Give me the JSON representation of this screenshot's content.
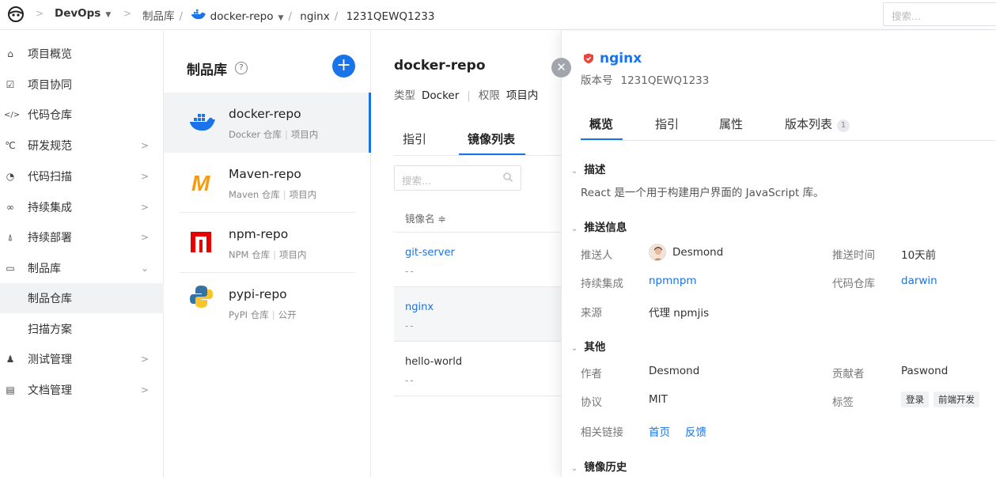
{
  "topbar": {
    "project": "DevOps",
    "breadcrumb": [
      "制品库",
      "docker-repo",
      "nginx",
      "1231QEWQ1233"
    ],
    "search_placeholder": "搜索..."
  },
  "nav": {
    "items": [
      {
        "label": "项目概览",
        "icon": "overview-icon"
      },
      {
        "label": "项目协同",
        "icon": "collab-icon"
      },
      {
        "label": "代码仓库",
        "icon": "code-icon"
      },
      {
        "label": "研发规范",
        "icon": "rule-icon"
      },
      {
        "label": "代码扫描",
        "icon": "scan-icon"
      },
      {
        "label": "持续集成",
        "icon": "ci-icon"
      },
      {
        "label": "持续部署",
        "icon": "deploy-icon"
      },
      {
        "label": "制品库",
        "icon": "artifact-icon"
      },
      {
        "label": "制品仓库",
        "icon": ""
      },
      {
        "label": "扫描方案",
        "icon": ""
      },
      {
        "label": "测试管理",
        "icon": "test-icon"
      },
      {
        "label": "文档管理",
        "icon": "doc-icon"
      }
    ]
  },
  "repos": {
    "title": "制品库",
    "items": [
      {
        "name": "docker-repo",
        "type": "Docker 仓库",
        "scope": "项目内"
      },
      {
        "name": "Maven-repo",
        "type": "Maven 仓库",
        "scope": "项目内"
      },
      {
        "name": "npm-repo",
        "type": "NPM 仓库",
        "scope": "项目内"
      },
      {
        "name": "pypi-repo",
        "type": "PyPI 仓库",
        "scope": "公开"
      }
    ]
  },
  "middle": {
    "title": "docker-repo",
    "type_label": "类型",
    "type_value": "Docker",
    "perm_label": "权限",
    "perm_value": "项目内",
    "tabs": [
      "指引",
      "镜像列表"
    ],
    "search_placeholder": "搜索...",
    "column_header": "镜像名 ≑",
    "images": [
      {
        "name": "git-server",
        "sub": "--"
      },
      {
        "name": "nginx",
        "sub": "--"
      },
      {
        "name": "hello-world",
        "sub": "--"
      }
    ]
  },
  "detail": {
    "title": "nginx",
    "version_label": "版本号",
    "version_value": "1231QEWQ1233",
    "tabs": [
      "概览",
      "指引",
      "属性",
      "版本列表"
    ],
    "version_count": "1",
    "sections": {
      "desc_title": "描述",
      "desc_text": "React 是一个用于构建用户界面的 JavaScript 库。",
      "push_title": "推送信息",
      "other_title": "其他",
      "history_title": "镜像历史"
    },
    "push": {
      "pusher_label": "推送人",
      "pusher_value": "Desmond",
      "time_label": "推送时间",
      "time_value": "10天前",
      "ci_label": "持续集成",
      "ci_value": "npmnpm",
      "repo_label": "代码仓库",
      "repo_value": "darwin",
      "source_label": "来源",
      "source_value": "代理 npmjis"
    },
    "other": {
      "author_label": "作者",
      "author_value": "Desmond",
      "contrib_label": "贡献者",
      "contrib_value": "Paswond",
      "license_label": "协议",
      "license_value": "MIT",
      "tags_label": "标签",
      "tags": [
        "登录",
        "前端开发"
      ],
      "links_label": "相关链接",
      "links": [
        "首页",
        "反馈"
      ]
    }
  }
}
